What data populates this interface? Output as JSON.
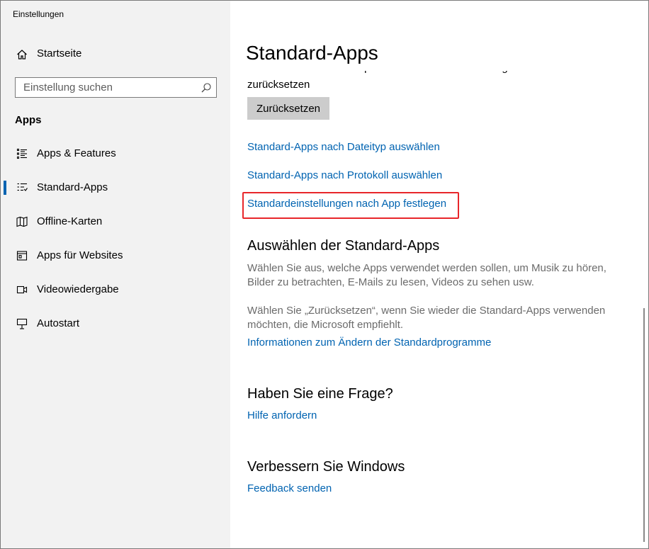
{
  "window": {
    "title": "Einstellungen",
    "controls": [
      "minimize-icon",
      "maximize-icon",
      "close-icon"
    ]
  },
  "sidebar": {
    "home_label": "Startseite",
    "home_icon": "home-icon",
    "search": {
      "placeholder": "Einstellung suchen",
      "icon": "search-icon"
    },
    "section_title": "Apps",
    "items": [
      {
        "label": "Apps & Features",
        "icon": "apps-features-icon",
        "active": false
      },
      {
        "label": "Standard-Apps",
        "icon": "default-apps-icon",
        "active": true
      },
      {
        "label": "Offline-Karten",
        "icon": "offline-maps-icon",
        "active": false
      },
      {
        "label": "Apps für Websites",
        "icon": "apps-websites-icon",
        "active": false
      },
      {
        "label": "Videowiedergabe",
        "icon": "video-playback-icon",
        "active": false
      },
      {
        "label": "Autostart",
        "icon": "startup-icon",
        "active": false
      }
    ],
    "accent_color": "#0063b1"
  },
  "main": {
    "title": "Standard-Apps",
    "reset_text_partial": "Auf die von Microsoft empfohlenen Standardeinstellungen",
    "reset_text_line2": "zurücksetzen",
    "reset_button": "Zurücksetzen",
    "links": {
      "by_filetype": "Standard-Apps nach Dateityp auswählen",
      "by_protocol": "Standard-Apps nach Protokoll auswählen",
      "by_app": "Standardeinstellungen nach App festlegen"
    },
    "choose_section": {
      "heading": "Auswählen der Standard-Apps",
      "para1_line1": "Wählen Sie aus, welche Apps verwendet werden sollen, um Musik zu hören,",
      "para1_line2": "Bilder zu betrachten, E-Mails zu lesen, Videos zu sehen usw.",
      "para2_line1": "Wählen Sie „Zurücksetzen“, wenn Sie wieder die Standard-Apps verwenden",
      "para2_line2": "möchten, die Microsoft empfiehlt.",
      "link": "Informationen zum Ändern der Standardprogramme"
    },
    "question_section": {
      "heading": "Haben Sie eine Frage?",
      "link": "Hilfe anfordern"
    },
    "improve_section": {
      "heading": "Verbessern Sie Windows",
      "link": "Feedback senden"
    },
    "link_color": "#0063b1",
    "highlight_color": "#e8262a"
  }
}
